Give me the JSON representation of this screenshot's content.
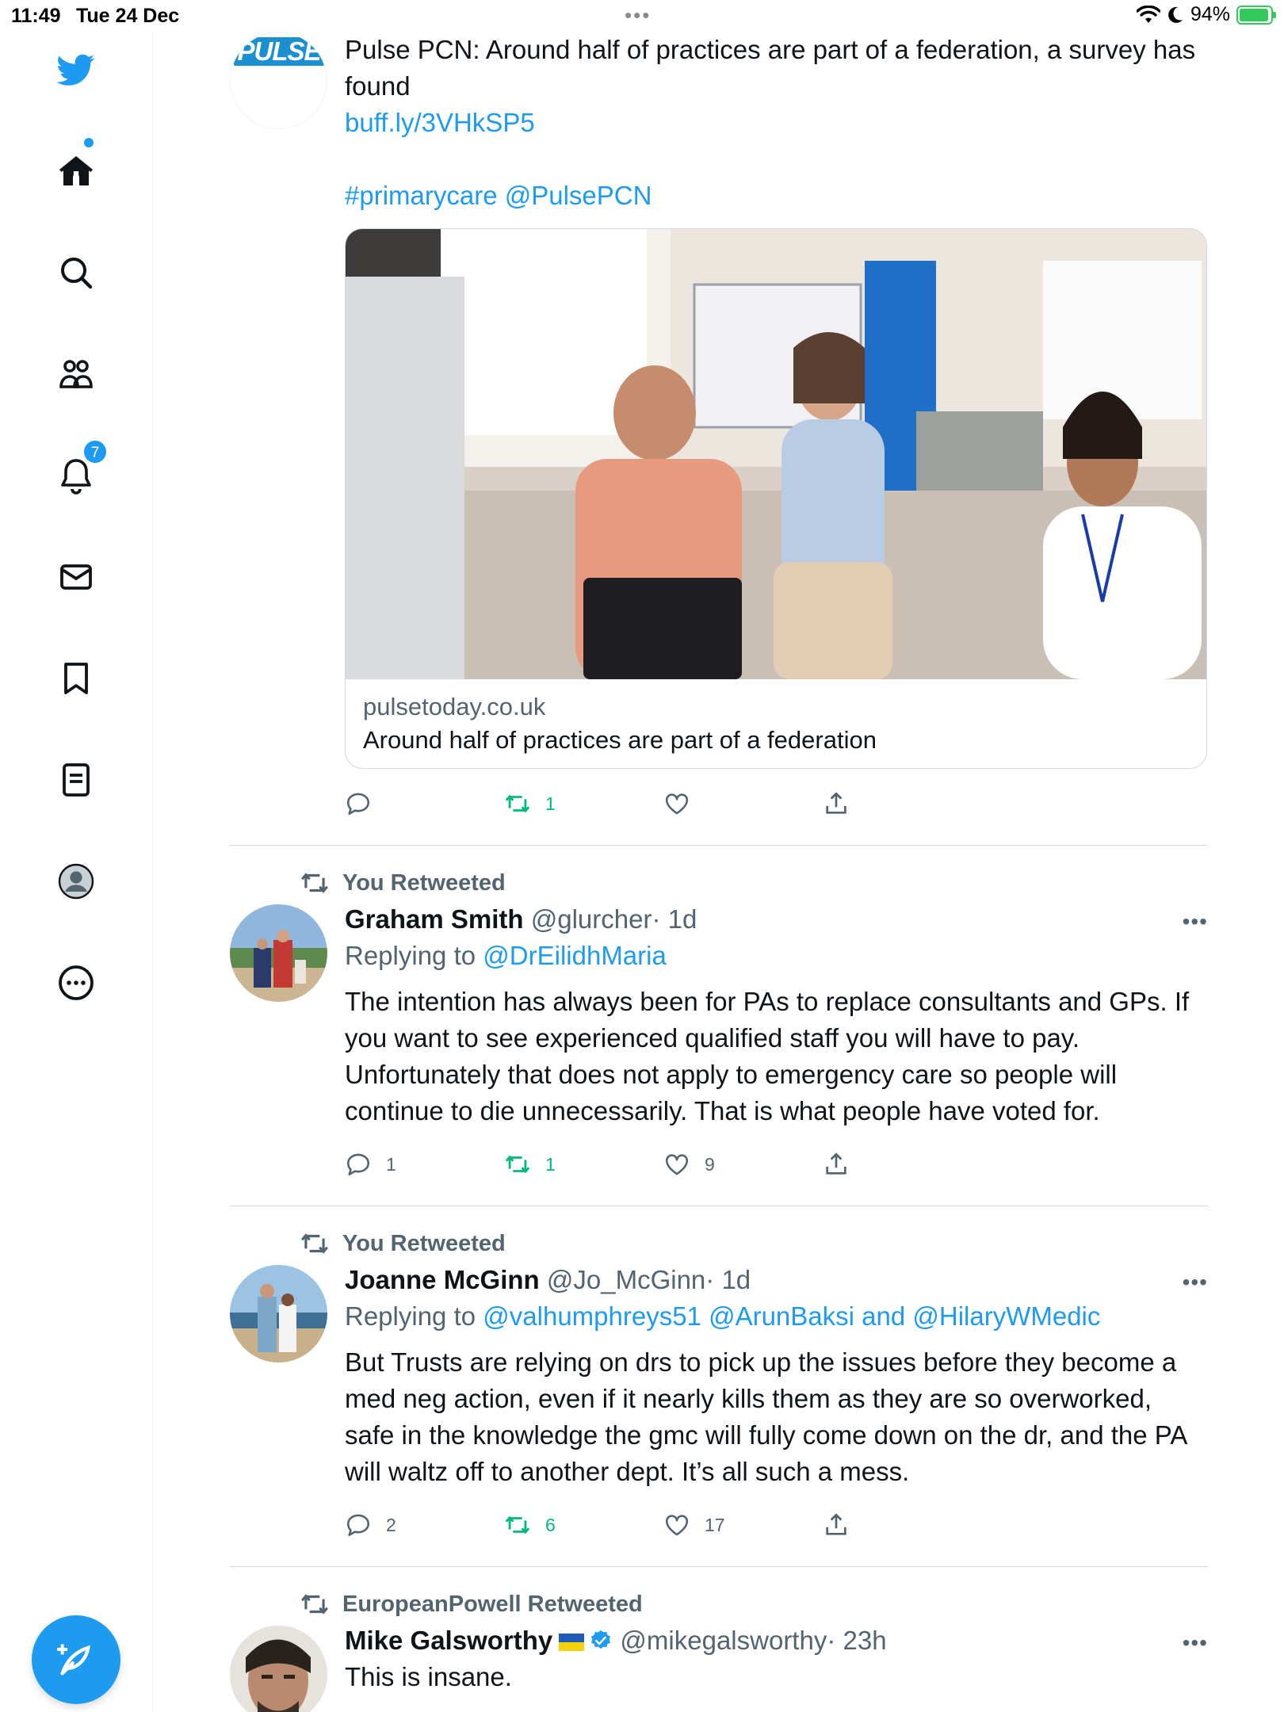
{
  "status_bar": {
    "time": "11:49",
    "date": "Tue 24 Dec",
    "battery": "94%"
  },
  "sidebar": {
    "items": [
      {
        "name": "twitter-logo"
      },
      {
        "name": "home"
      },
      {
        "name": "explore"
      },
      {
        "name": "communities"
      },
      {
        "name": "notifications",
        "badge": "7"
      },
      {
        "name": "messages"
      },
      {
        "name": "bookmarks"
      },
      {
        "name": "lists"
      },
      {
        "name": "profile"
      },
      {
        "name": "more"
      }
    ],
    "notification_badge": "7",
    "accent": "#1d9bf0"
  },
  "tweets": [
    {
      "author_logo_text": "PULSE",
      "text": "Pulse PCN: Around half of practices are part of a federation, a survey has found",
      "link": "buff.ly/3VHkSP5",
      "hashtags": "#primarycare @PulsePCN",
      "card": {
        "domain": "pulsetoday.co.uk",
        "title": "Around half of practices are part of a federation"
      },
      "actions": {
        "replies": "",
        "retweets": "1",
        "likes": "",
        "retweeted": true
      }
    },
    {
      "retweet_label": "You Retweeted",
      "name": "Graham Smith",
      "handle": "@glurcher",
      "time": "· 1d",
      "replying_prefix": "Replying to",
      "replying_to": "@DrEilidhMaria",
      "text": "The intention has always been for PAs to replace consultants and GPs. If you want to see experienced qualified staff you will have to pay. Unfortunately that does not apply to emergency care so people will continue to die unnecessarily. That is what people have voted for.",
      "actions": {
        "replies": "1",
        "retweets": "1",
        "likes": "9",
        "retweeted": true
      }
    },
    {
      "retweet_label": "You Retweeted",
      "name": "Joanne McGinn",
      "handle": "@Jo_McGinn",
      "time": "· 1d",
      "replying_prefix": "Replying to",
      "replying_to": "@valhumphreys51 @ArunBaksi and @HilaryWMedic",
      "text": "But Trusts are relying on drs to pick up the issues before they become a med neg action, even if it nearly kills them as they are so overworked, safe in the knowledge the gmc will fully come down on the dr, and the PA will waltz off to another dept. It’s all such a mess.",
      "actions": {
        "replies": "2",
        "retweets": "6",
        "likes": "17",
        "retweeted": true
      }
    },
    {
      "retweet_label": "EuropeanPowell Retweeted",
      "name": "Mike Galsworthy",
      "handle": "@mikegalsworthy",
      "time": "· 23h",
      "text": "This is insane."
    }
  ]
}
